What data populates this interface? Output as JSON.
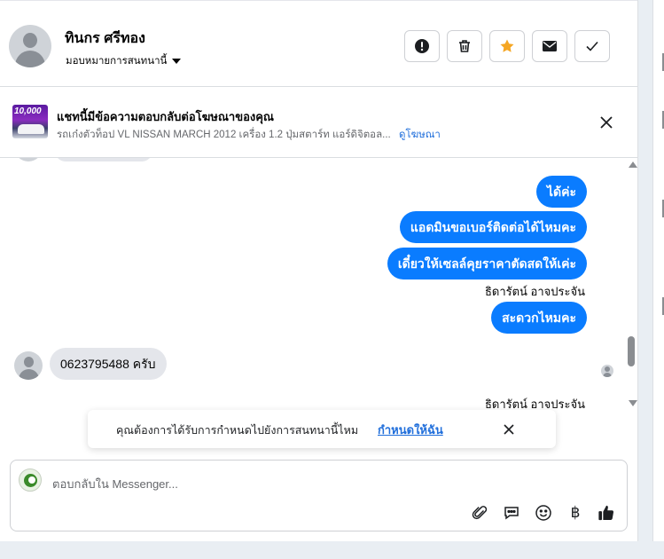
{
  "header": {
    "contact_name": "ทินกร ศรีทอง",
    "assign_label": "มอบหมายการสนทนานี้",
    "actions": [
      {
        "name": "spam-button",
        "icon": "exclamation-icon"
      },
      {
        "name": "delete-button",
        "icon": "trash-icon"
      },
      {
        "name": "star-button",
        "icon": "star-icon"
      },
      {
        "name": "mark-unread-button",
        "icon": "envelope-icon"
      },
      {
        "name": "mark-done-button",
        "icon": "checkmark-icon"
      }
    ]
  },
  "ad_reply": {
    "title": "แชทนี้มีข้อความตอบกลับต่อโฆษณาของคุณ",
    "thumbnail_text": "10,000",
    "description": "รถเก๋งตัวท็อป VL NISSAN MARCH 2012 เครื่อง 1.2 ปุ่มสตาร์ท แอร์ดิจิตอล...",
    "view_ad_link": "ดูโฆษณา"
  },
  "messages": {
    "out_1": "ได้ค่ะ",
    "out_2": "แอดมินขอเบอร์ติดต่อได้ไหมคะ",
    "out_3": "เดี๋ยวให้เซลล์คุยราคาตัดสดให้เค่ะ",
    "sender_1": "ธิดารัตน์ อาจประจัน",
    "out_4": "สะดวกไหมคะ",
    "in_1": "0623795488 ครับ",
    "sender_2": "ธิดารัตน์ อาจประจัน"
  },
  "reminder": {
    "text": "คุณต้องการได้รับการกำหนดไปยังการสนทนานี้ไหม",
    "link": "กำหนดให้ฉัน"
  },
  "composer": {
    "placeholder": "ตอบกลับใน Messenger...",
    "currency_symbol": "฿"
  },
  "colors": {
    "accent": "#0a7cff",
    "star": "#f5a623",
    "link": "#216fdb"
  }
}
